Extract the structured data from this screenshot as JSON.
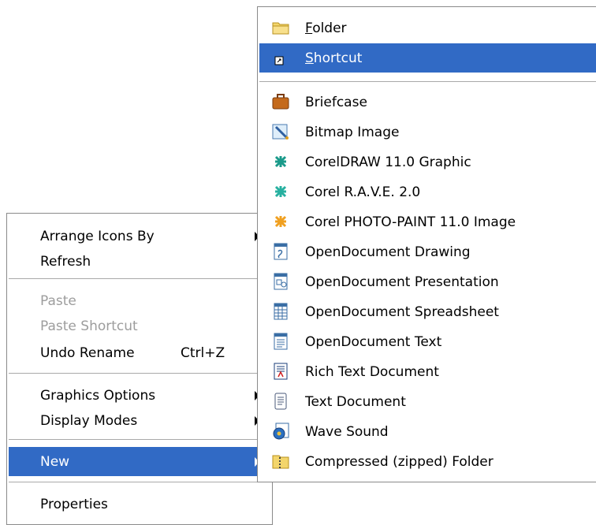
{
  "context_menu": {
    "arrange": "Arrange Icons By",
    "refresh": "Refresh",
    "paste": "Paste",
    "paste_shortcut": "Paste Shortcut",
    "undo_rename": "Undo Rename",
    "undo_shortcut": "Ctrl+Z",
    "graphics_options": "Graphics Options",
    "display_modes": "Display Modes",
    "new": "New",
    "properties": "Properties"
  },
  "new_submenu": {
    "folder_first": "F",
    "folder_rest": "older",
    "shortcut_first": "S",
    "shortcut_rest": "hortcut",
    "items": [
      "Briefcase",
      "Bitmap Image",
      "CorelDRAW 11.0 Graphic",
      "Corel R.A.V.E. 2.0",
      "Corel PHOTO-PAINT 11.0 Image",
      "OpenDocument Drawing",
      "OpenDocument Presentation",
      "OpenDocument Spreadsheet",
      "OpenDocument Text",
      "Rich Text Document",
      "Text Document",
      "Wave Sound",
      "Compressed (zipped) Folder"
    ]
  },
  "colors": {
    "highlight": "#316ac5",
    "disabled": "#9d9d9d"
  }
}
